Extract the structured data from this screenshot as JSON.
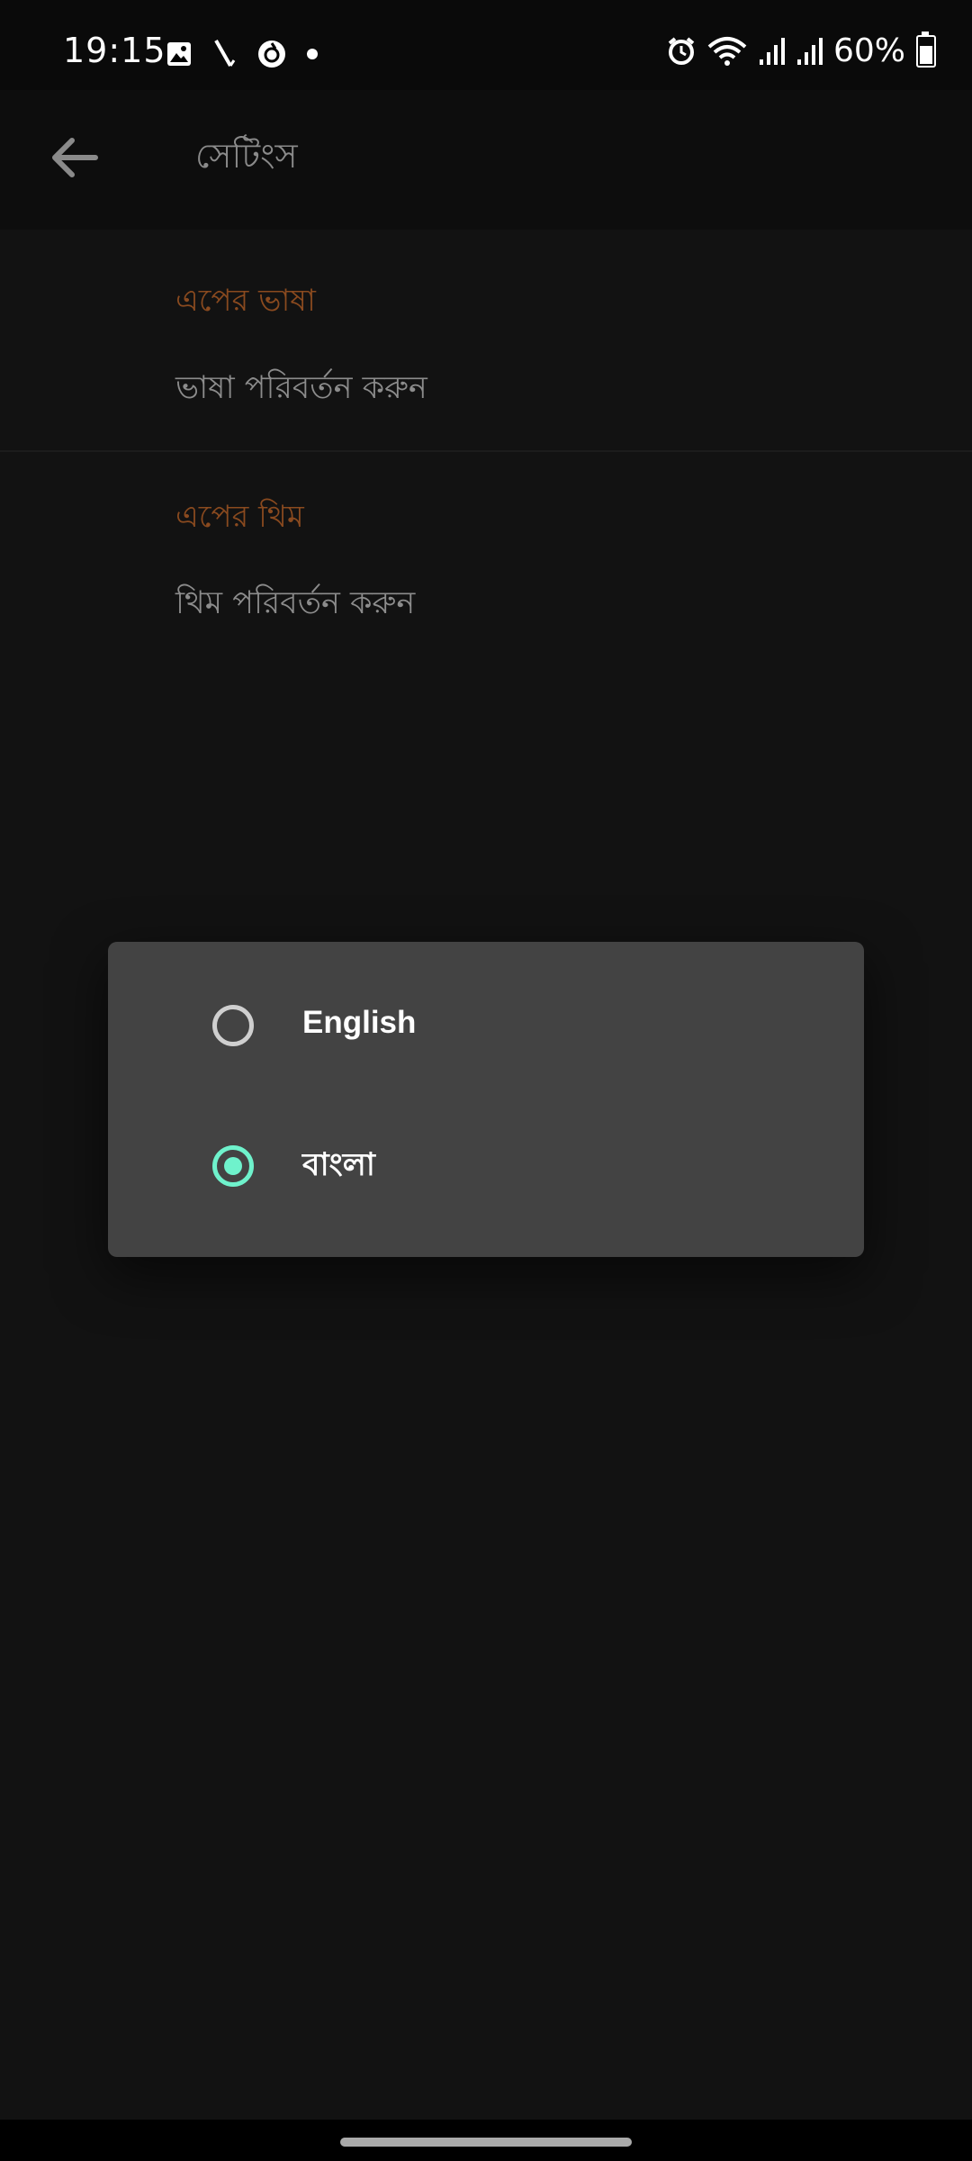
{
  "status_bar": {
    "time": "19:15",
    "battery": "60%",
    "icons_left": [
      "image-icon",
      "pen-icon",
      "app-icon",
      "dot-icon"
    ],
    "icons_right": [
      "alarm-icon",
      "wifi-icon",
      "signal-icon",
      "signal-icon",
      "battery-icon"
    ],
    "battery_level": 0.6
  },
  "app_bar": {
    "title": "সেটিংস",
    "back_icon": "back-arrow-icon"
  },
  "settings": {
    "language": {
      "header": "এপের ভাষা",
      "item": "ভাষা পরিবর্তন করুন"
    },
    "theme": {
      "header": "এপের থিম",
      "item": "থিম পরিবর্তন করুন"
    }
  },
  "language_dialog": {
    "options": [
      {
        "label": "English",
        "selected": false
      },
      {
        "label": "বাংলা",
        "selected": true
      }
    ]
  },
  "colors": {
    "accent": "#6ff2cc",
    "section_header": "#8a4a1f",
    "dialog_bg": "#434343",
    "page_bg": "#121212"
  }
}
